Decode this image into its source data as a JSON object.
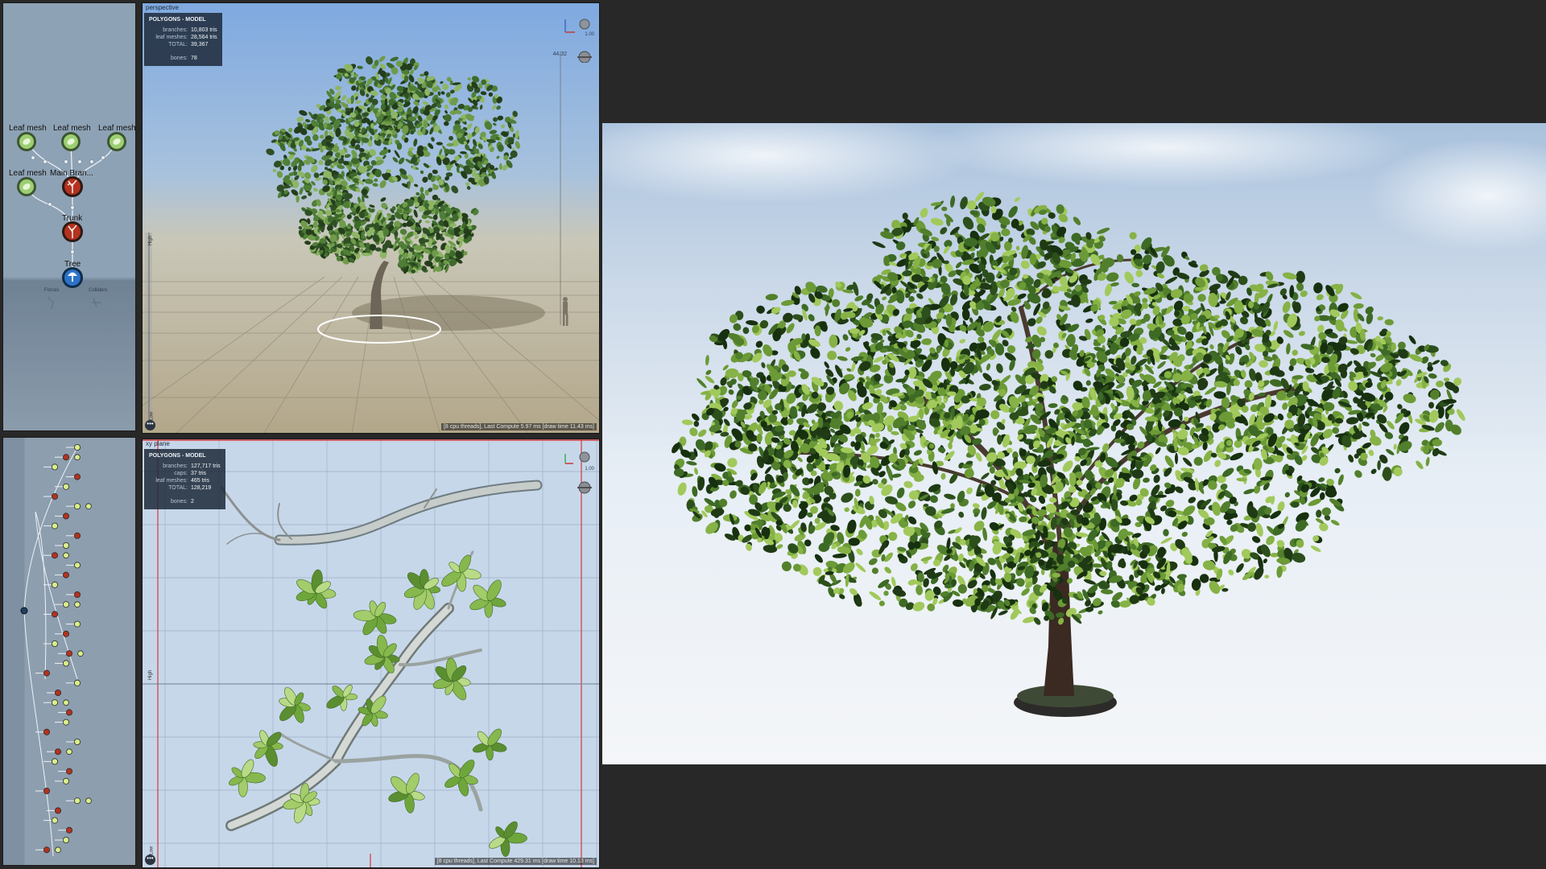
{
  "node_graph": {
    "nodes": [
      {
        "label": "Leaf mesh",
        "kind": "leaf"
      },
      {
        "label": "Leaf mesh",
        "kind": "leaf"
      },
      {
        "label": "Leaf mesh",
        "kind": "leaf"
      },
      {
        "label": "Leaf mesh",
        "kind": "leaf"
      },
      {
        "label": "Main Bran...",
        "kind": "branch"
      },
      {
        "label": "Trunk",
        "kind": "trunk"
      },
      {
        "label": "Tree",
        "kind": "tree"
      }
    ],
    "bottom_labels": [
      "Forces",
      "Colliders"
    ]
  },
  "perspective_view": {
    "title": "perspective",
    "stats_header": "POLYGONS - MODEL",
    "stats": [
      {
        "key": "branches:",
        "value": "10,803 tris"
      },
      {
        "key": "leaf meshes:",
        "value": "28,564 tris"
      },
      {
        "key": "TOTAL:",
        "value": "39,367"
      },
      {
        "key": "bones:",
        "value": "78"
      }
    ],
    "height_readout": "44.32",
    "gizmo_value": "1.00",
    "footer": "[8 cpu threads], Last Compute 5.97 ms [draw time 11.43 ms]",
    "side_label_high": "High",
    "side_label_low": "Low",
    "menu_button": "•••"
  },
  "xy_view": {
    "title": "xy plane",
    "stats_header": "POLYGONS - MODEL",
    "stats": [
      {
        "key": "branches:",
        "value": "127,717 tris"
      },
      {
        "key": "caps:",
        "value": "37 tris"
      },
      {
        "key": "leaf meshes:",
        "value": "465 tris"
      },
      {
        "key": "TOTAL:",
        "value": "128,219"
      },
      {
        "key": "bones:",
        "value": "2"
      }
    ],
    "gizmo_value": "1.00",
    "footer": "[8 cpu threads], Last Compute 429.31 ms [draw time 10.13 ms]",
    "side_label_high": "High",
    "side_label_low": "Low",
    "menu_button": "•••"
  },
  "colors": {
    "leaf_node": "#9ccf73",
    "branch_node": "#b4321f",
    "tree_node": "#2a73c8",
    "foliage_dark": "#2f5a1f",
    "foliage_light": "#7fb342"
  },
  "icons": {
    "leaf_node": "leaf-node-icon",
    "branch_node": "branch-node-icon",
    "tree_node": "tree-node-icon",
    "camera_gizmo": "camera-gizmo-icon",
    "light_gizmo": "light-gizmo-icon",
    "axis": "axis-icon"
  }
}
